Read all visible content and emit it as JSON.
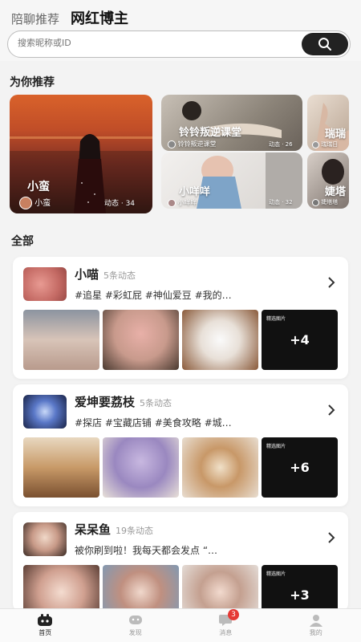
{
  "header": {
    "tabs": [
      "陪聊推荐",
      "网红博主"
    ],
    "search_placeholder": "搜索昵称或ID"
  },
  "recommend": {
    "title": "为你推荐",
    "cards": [
      {
        "name": "小蛮",
        "user": "小蛮",
        "posts": "动态 · 34"
      },
      {
        "name": "铃铃叛逆课堂",
        "user": "铃铃叛逆课堂",
        "posts": "动态 · 26"
      },
      {
        "name": "瑞瑞",
        "user": "瑞瑞日"
      },
      {
        "name": "小咩咩",
        "user": "小咩咩",
        "posts": "动态 · 32"
      },
      {
        "name": "婕塔",
        "user": "婕塔塔"
      }
    ]
  },
  "all": {
    "title": "全部",
    "feed": [
      {
        "name": "小喵",
        "count": "5条动态",
        "tags": "#追星 #彩虹屁 #神仙爱豆 #我的…",
        "more": "+4",
        "badge": "精选图片"
      },
      {
        "name": "爱坤要荔枝",
        "count": "5条动态",
        "tags": "#探店 #宝藏店铺 #美食攻略 #城…",
        "more": "+6",
        "badge": "精选图片"
      },
      {
        "name": "呆呆鱼",
        "count": "19条动态",
        "tags": "被你刷到啦！我每天都会发点 “…",
        "more": "+3",
        "badge": "精选图片"
      }
    ]
  },
  "nav": {
    "items": [
      "首页",
      "发现",
      "消息",
      "我的"
    ],
    "badge": "3"
  },
  "colors": {
    "accent": "#222222",
    "badge": "#e53935",
    "background": "#f3f3f3"
  }
}
